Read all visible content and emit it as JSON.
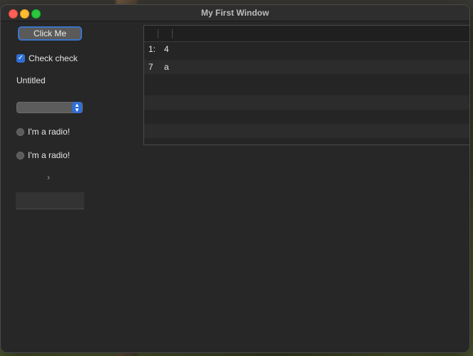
{
  "window": {
    "title": "My First Window"
  },
  "controls": {
    "button_label": "Click Me",
    "checkbox": {
      "label": "Check check",
      "checked": true
    },
    "static_label": "Untitled",
    "popup": {
      "selected": ""
    },
    "radios": [
      {
        "label": "I'm a radio!",
        "selected": false
      },
      {
        "label": "I'm a radio!",
        "selected": false
      }
    ],
    "disclosure": "›",
    "text_field": {
      "value": ""
    }
  },
  "table": {
    "columns": [
      "",
      ""
    ],
    "rows": [
      {
        "c0": "1:",
        "c1": "4"
      },
      {
        "c0": "7",
        "c1": "a"
      },
      {
        "c0": "",
        "c1": ""
      },
      {
        "c0": "",
        "c1": ""
      },
      {
        "c0": "",
        "c1": ""
      },
      {
        "c0": "",
        "c1": ""
      },
      {
        "c0": "",
        "c1": ""
      }
    ]
  },
  "colors": {
    "accent": "#2f6fd6",
    "window_bg": "#272727"
  }
}
